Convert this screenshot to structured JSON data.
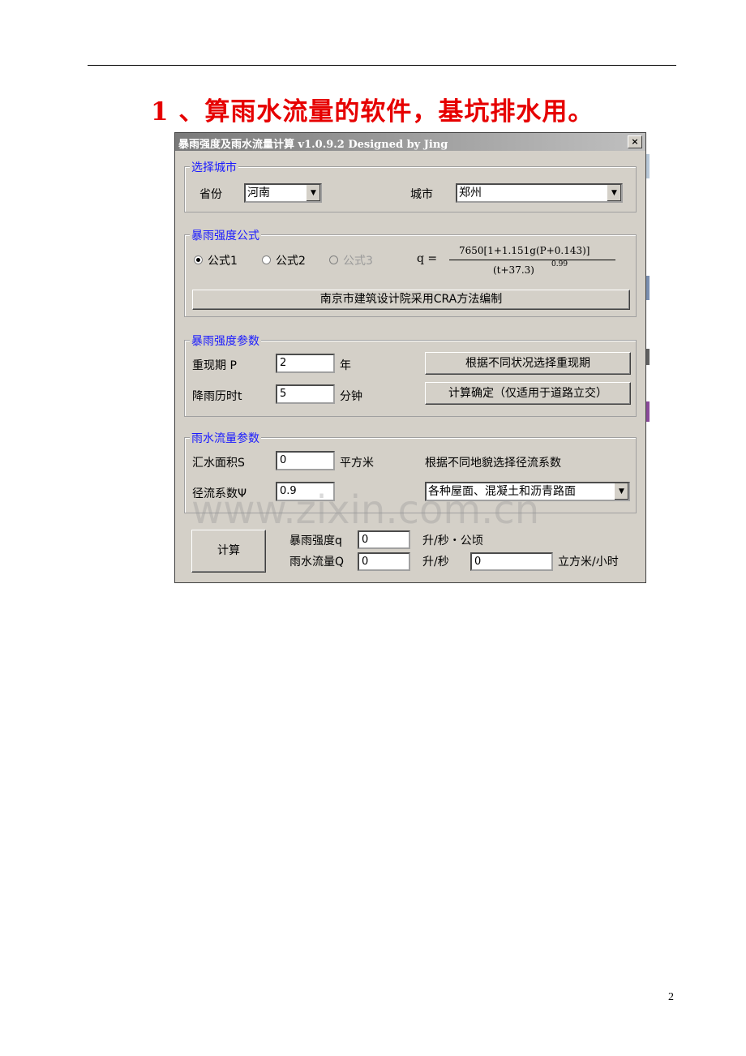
{
  "document": {
    "heading": "1 、算雨水流量的软件，基坑排水用。",
    "page_number": "2"
  },
  "window": {
    "title": "暴雨强度及雨水流量计算 v1.0.9.2 Designed by Jing",
    "close_glyph": "×"
  },
  "city_group": {
    "title": "选择城市",
    "province_label": "省份",
    "province_value": "河南",
    "city_label": "城市",
    "city_value": "郑州"
  },
  "formula_group": {
    "title": "暴雨强度公式",
    "options": [
      {
        "label": "公式1",
        "selected": true,
        "enabled": true
      },
      {
        "label": "公式2",
        "selected": false,
        "enabled": true
      },
      {
        "label": "公式3",
        "selected": false,
        "enabled": false
      }
    ],
    "formula_lhs": "q =",
    "formula_numerator": "7650[1+1.151g(P+0.143)]",
    "formula_denominator": "(t+37.3)",
    "formula_exponent": "0.99",
    "source_button": "南京市建筑设计院采用CRA方法编制"
  },
  "params_group": {
    "title": "暴雨强度参数",
    "period_label": "重现期  P",
    "period_value": "2",
    "period_unit": "年",
    "duration_label": "降雨历时t",
    "duration_value": "5",
    "duration_unit": "分钟",
    "choose_period_button": "根据不同状况选择重现期",
    "confirm_button": "计算确定（仅适用于道路立交）"
  },
  "flow_group": {
    "title": "雨水流量参数",
    "area_label": "汇水面积S",
    "area_value": "0",
    "area_unit": "平方米",
    "coef_hint": "根据不同地貌选择径流系数",
    "coef_label": "径流系数Ψ",
    "coef_value": "0.9",
    "surface_value": "各种屋面、混凝土和沥青路面"
  },
  "results": {
    "calc_button": "计算",
    "intensity_label": "暴雨强度q",
    "intensity_value": "0",
    "intensity_unit": "升/秒・公顷",
    "flow_label": "雨水流量Q",
    "flow_value": "0",
    "flow_unit": "升/秒",
    "flow_m3_value": "0",
    "flow_m3_unit": "立方米/小时"
  },
  "watermark": "www.zixin.com.cn"
}
